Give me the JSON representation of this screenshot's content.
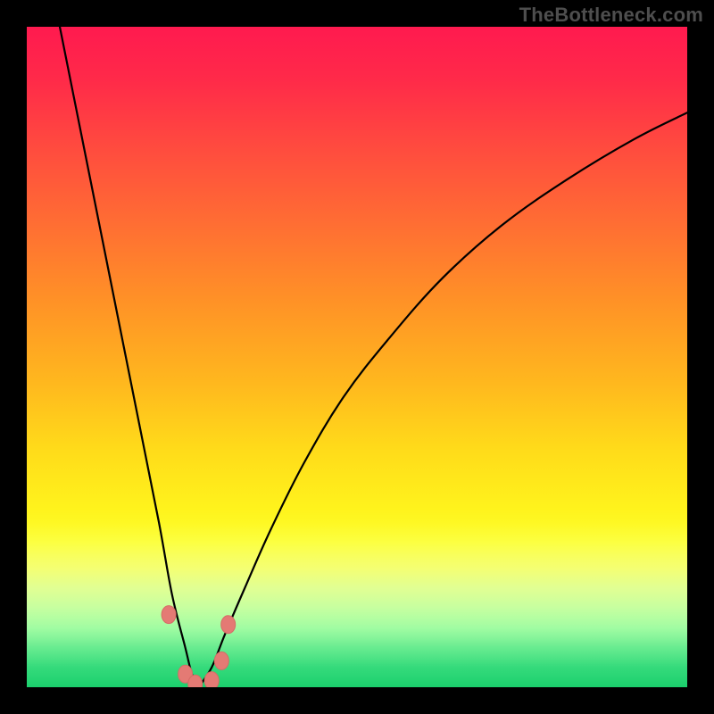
{
  "watermark": "TheBottleneck.com",
  "colors": {
    "background": "#000000",
    "curve": "#000000",
    "marker_fill": "#e47a74",
    "marker_stroke": "#d66b66",
    "gradient_stops": [
      "#ff1a4f",
      "#ff6e33",
      "#ffdb1a",
      "#fcff2e",
      "#54e981",
      "#1bd06d"
    ]
  },
  "chart_data": {
    "type": "line",
    "title": "",
    "xlabel": "",
    "ylabel": "",
    "xlim": [
      0,
      100
    ],
    "ylim": [
      0,
      100
    ],
    "grid": false,
    "legend": false,
    "note": "Bottleneck-style V curve; minimum near x≈26; values are percentage-of-plot-height estimated from pixels.",
    "series": [
      {
        "name": "left-branch",
        "x": [
          5,
          8,
          11,
          14,
          17,
          20,
          22,
          24,
          25,
          26
        ],
        "y": [
          100,
          85,
          70,
          55,
          40,
          25,
          14,
          6,
          2,
          0
        ]
      },
      {
        "name": "right-branch",
        "x": [
          26,
          28,
          30,
          33,
          37,
          42,
          48,
          55,
          63,
          72,
          82,
          92,
          100
        ],
        "y": [
          0,
          3,
          8,
          15,
          24,
          34,
          44,
          53,
          62,
          70,
          77,
          83,
          87
        ]
      }
    ],
    "markers": {
      "name": "trough-markers",
      "x": [
        21.5,
        24.0,
        25.5,
        28.0,
        29.5,
        30.5
      ],
      "y": [
        11.0,
        2.0,
        0.5,
        1.0,
        4.0,
        9.5
      ]
    }
  }
}
